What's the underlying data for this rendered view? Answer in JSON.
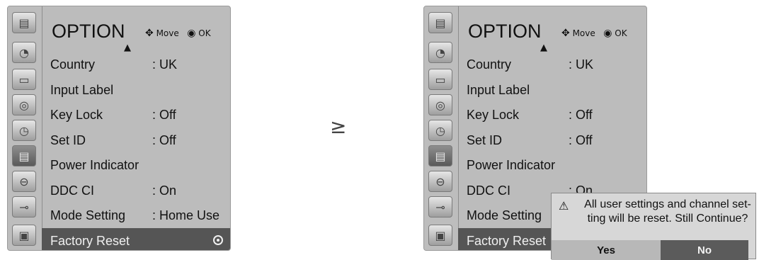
{
  "menu": {
    "title": "OPTION",
    "hint_move": "Move",
    "hint_ok": "OK",
    "items": [
      {
        "label": "Country",
        "value": ": UK"
      },
      {
        "label": "Input Label",
        "value": ""
      },
      {
        "label": "Key Lock",
        "value": ": Off"
      },
      {
        "label": "Set ID",
        "value": ": Off"
      },
      {
        "label": "Power Indicator",
        "value": ""
      },
      {
        "label": "DDC CI",
        "value": ": On"
      },
      {
        "label": "Mode Setting",
        "value": ": Home Use"
      },
      {
        "label": "Factory Reset",
        "value": ""
      }
    ],
    "selected": "Factory Reset"
  },
  "sidebar_icons": [
    "option-icon",
    "satellite-dish-icon",
    "monitor-icon",
    "speaker-icon",
    "clock-icon",
    "option-active-icon",
    "lock-icon",
    "cable-icon",
    "photo-icon"
  ],
  "transition_arrow": "≥",
  "dialog": {
    "message": "All user settings and channel set-ting will be reset. Still Continue?",
    "yes_label": "Yes",
    "no_label": "No",
    "focused": "No"
  },
  "colors": {
    "panel_bg": "#bcbcbc",
    "selection": "#555555",
    "dialog_bg": "#d7d7d7",
    "button_focus": "#5b5b5b"
  }
}
